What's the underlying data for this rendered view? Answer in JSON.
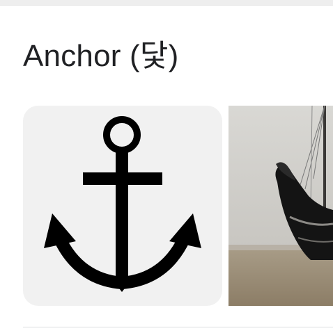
{
  "header": {
    "title": "Anchor (닻)"
  },
  "images": [
    {
      "icon": "anchor-icon"
    },
    {
      "icon": "ship-bow-photo"
    }
  ],
  "colors": {
    "text": "#202124",
    "card_bg": "#f1f1f1",
    "icon": "#000000"
  }
}
